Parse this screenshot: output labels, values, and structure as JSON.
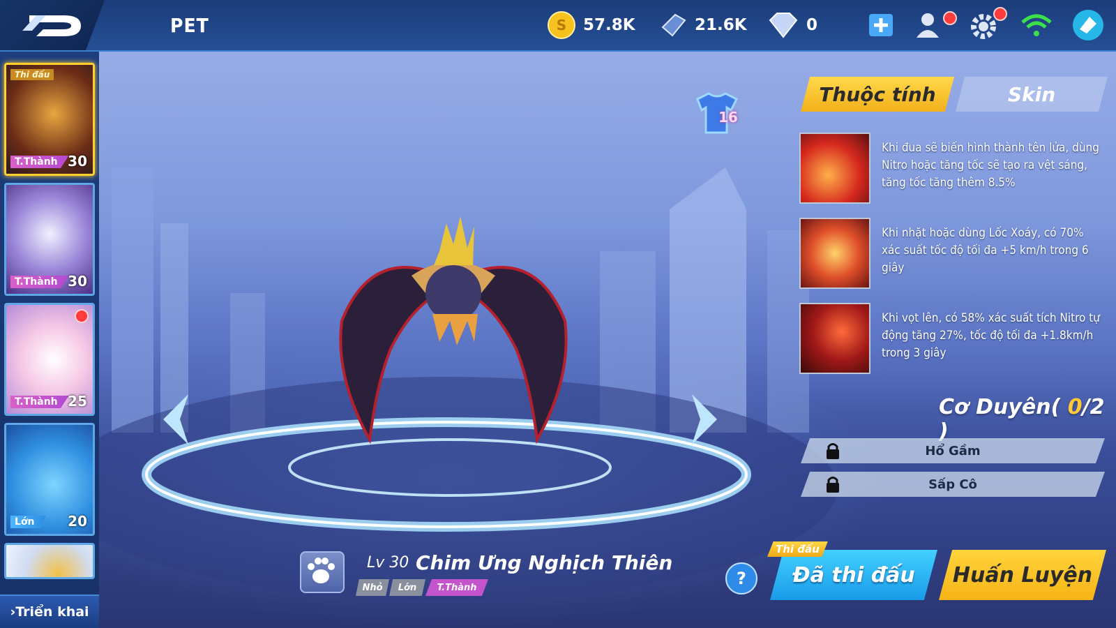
{
  "header": {
    "title": "PET",
    "gold": "57.8K",
    "gems": "21.6K",
    "diamonds": "0"
  },
  "pet_list": {
    "items": [
      {
        "badge": "Thi đấu",
        "tag": "T.Thành",
        "level": "30",
        "selected": true
      },
      {
        "badge": "",
        "tag": "T.Thành",
        "level": "30",
        "selected": false
      },
      {
        "badge": "",
        "tag": "T.Thành",
        "level": "25",
        "selected": false
      },
      {
        "badge": "",
        "tag": "Lớn",
        "level": "20",
        "selected": false
      }
    ],
    "deploy_label": "Triển khai"
  },
  "pet": {
    "level": "Lv 30",
    "name": "Chim Ưng Nghịch Thiên",
    "sizes": [
      "Nhỏ",
      "Lớn",
      "T.Thành"
    ],
    "active_size": "T.Thành",
    "shirt_count": "16"
  },
  "tabs": {
    "attributes": "Thuộc tính",
    "skin": "Skin"
  },
  "skills": [
    {
      "icon": "flame-trail-icon",
      "text": "Khi đua sẽ biến hình thành tên lửa, dùng Nitro hoặc tăng tốc sẽ tạo ra vệt sáng, tăng tốc tăng thêm 8.5%"
    },
    {
      "icon": "tornado-icon",
      "text": "Khi nhặt hoặc dùng Lốc Xoáy, có 70% xác suất tốc độ tối đa +5 km/h trong 6 giây"
    },
    {
      "icon": "wing-icon",
      "text": "Khi vọt lên, có 58% xác suất tích Nitro tự động tăng 27%, tốc độ tối đa +1.8km/h trong 3 giây"
    }
  ],
  "bond": {
    "label": "Cơ Duyên",
    "open": "( ",
    "current": "0",
    "rest": "/2 )",
    "rows": [
      "Hổ Gầm",
      "Sấp Cô"
    ]
  },
  "actions": {
    "compete_tag": "Thi đấu",
    "compete": "Đã thi đấu",
    "train": "Huấn Luyện",
    "help": "?"
  },
  "colors": {
    "accent_yellow": "#ffcf30",
    "accent_blue": "#22a8f0",
    "tag_purple": "#c454cc"
  }
}
